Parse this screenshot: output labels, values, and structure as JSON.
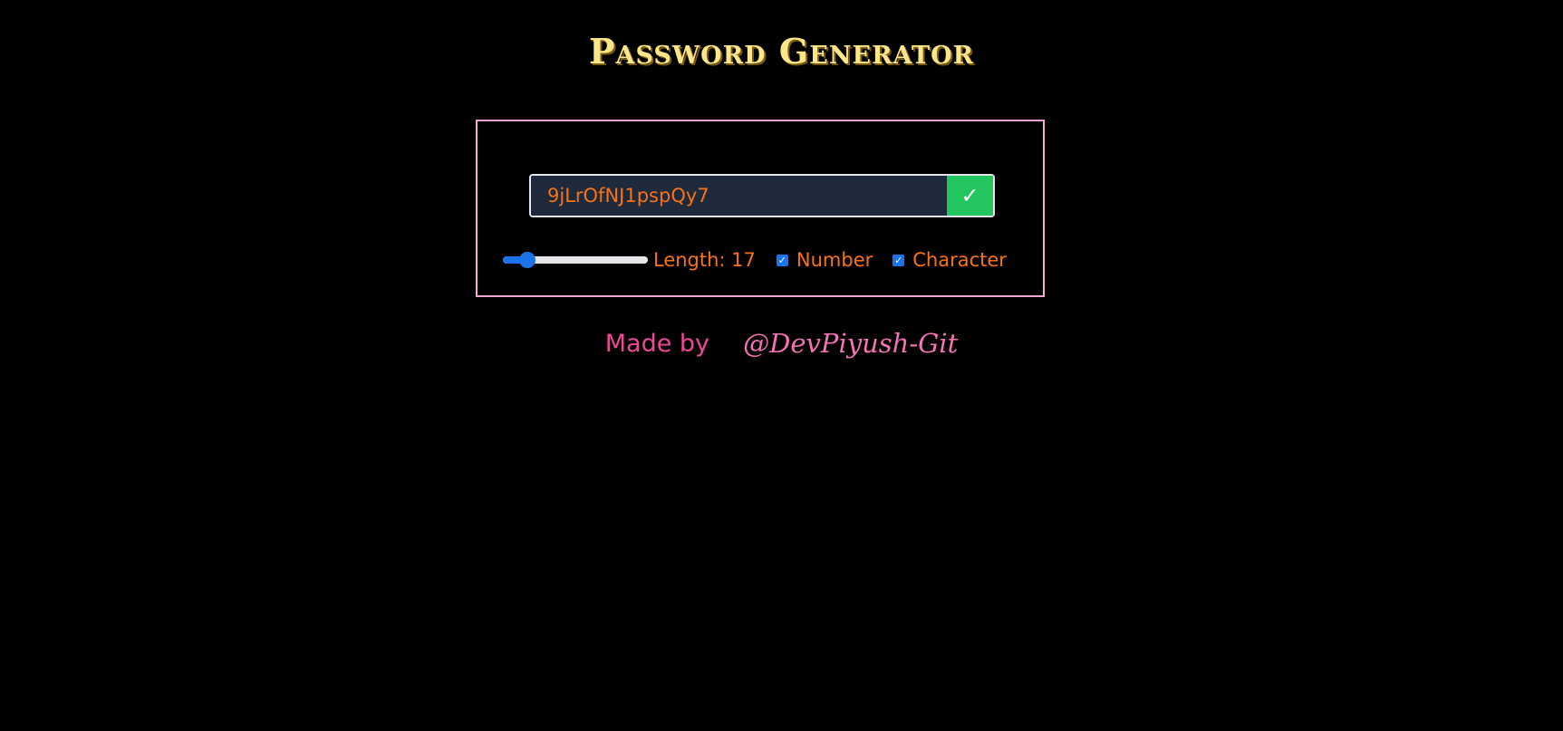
{
  "app": {
    "title": "Password Generator"
  },
  "generator": {
    "password_value": "9jLrOfNJ1pspQy7",
    "copy_icon": "check-icon",
    "copy_glyph": "✓",
    "length_label": "Length: 17",
    "length_level": 0.17,
    "number_label": "Number",
    "number_checked": true,
    "character_label": "Character",
    "character_checked": true
  },
  "footer": {
    "made_by": "Made by",
    "handle": "@DevPiyush-Git"
  },
  "colors": {
    "background": "#000000",
    "title": "#fde68a",
    "card_border": "#f9a8d4",
    "input_bg": "#1e293b",
    "accent_text": "#f97316",
    "copy_button": "#22c55e",
    "control_blue": "#1a73e8",
    "footer_pink": "#ec4899"
  }
}
